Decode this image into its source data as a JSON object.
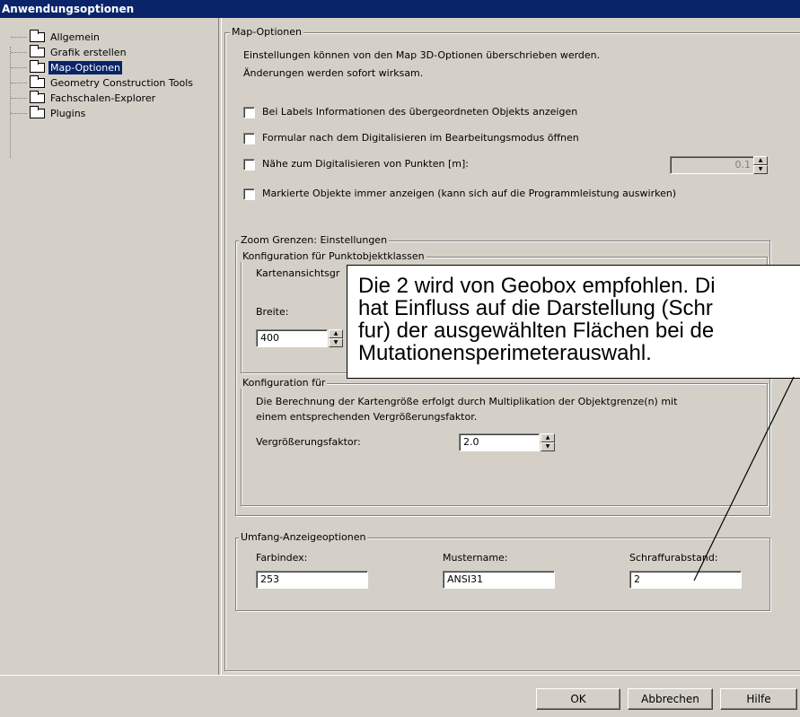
{
  "window": {
    "title": "Anwendungsoptionen"
  },
  "tree": {
    "items": [
      {
        "label": "Allgemein",
        "selected": false
      },
      {
        "label": "Grafik erstellen",
        "selected": false
      },
      {
        "label": "Map-Optionen",
        "selected": true
      },
      {
        "label": "Geometry Construction Tools",
        "selected": false
      },
      {
        "label": "Fachschalen-Explorer",
        "selected": false
      },
      {
        "label": "Plugins",
        "selected": false
      }
    ]
  },
  "map_options": {
    "legend": "Map-Optionen",
    "description_line1": "Einstellungen können von den Map 3D-Optionen überschrieben werden.",
    "description_line2": "Änderungen werden sofort wirksam.",
    "checkboxes": [
      {
        "label": "Bei Labels Informationen des übergeordneten Objekts anzeigen",
        "checked": false
      },
      {
        "label": "Formular nach dem Digitalisieren im Bearbeitungsmodus öffnen",
        "checked": false
      },
      {
        "label": "Nähe zum Digitalisieren von Punkten [m]:",
        "checked": false
      },
      {
        "label": "Markierte Objekte immer anzeigen (kann sich auf die Programmleistung auswirken)",
        "checked": false
      }
    ],
    "proximity_value": "0.1"
  },
  "zoom": {
    "legend": "Zoom Grenzen: Einstellungen",
    "point_config_legend": "Konfiguration für Punktobjektklassen",
    "map_view_label": "Kartenansichtsgr",
    "width_label": "Breite:",
    "width_value": "400",
    "second_config_legend": "Konfiguration für",
    "calc_text_line1": "Die Berechnung der Kartengröße erfolgt durch Multiplikation der Objektgrenze(n) mit",
    "calc_text_line2": "einem entsprechenden Vergrößerungsfaktor.",
    "factor_label": "Vergrößerungsfaktor:",
    "factor_value": "2.0"
  },
  "extent": {
    "legend": "Umfang-Anzeigeoptionen",
    "color_index_label": "Farbindex:",
    "color_index_value": "253",
    "pattern_name_label": "Mustername:",
    "pattern_name_value": "ANSI31",
    "hatch_spacing_label": "Schraffurabstand:",
    "hatch_spacing_value": "2"
  },
  "callout": {
    "line1": "Die 2 wird von Geobox empfohlen. Di",
    "line2": "hat Einfluss auf die Darstellung (Schr",
    "line3": "fur) der ausgewählten Flächen bei de",
    "line4": "Mutationensperimeterauswahl."
  },
  "buttons": {
    "ok": "OK",
    "cancel": "Abbrechen",
    "help": "Hilfe"
  },
  "icons": {
    "tree_item": "folder-icon",
    "spin_up": "spin-up-icon",
    "spin_down": "spin-down-icon"
  }
}
